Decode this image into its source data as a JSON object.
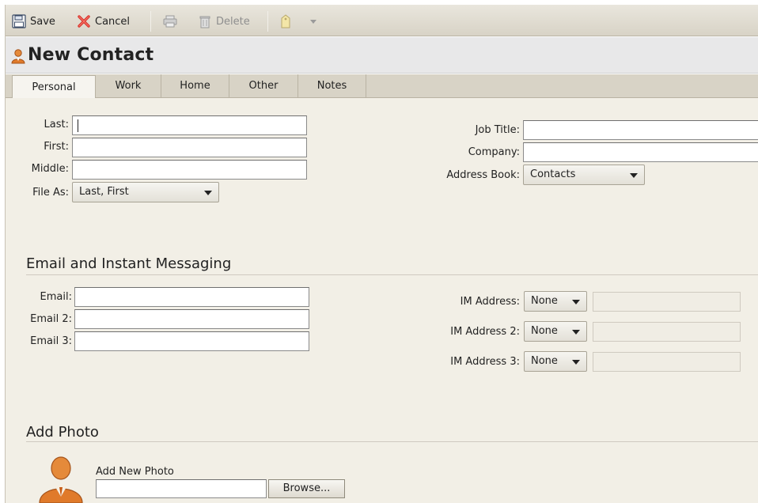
{
  "toolbar": {
    "save_label": "Save",
    "cancel_label": "Cancel",
    "delete_label": "Delete"
  },
  "header": {
    "title": "New Contact"
  },
  "tabs": [
    {
      "label": "Personal",
      "active": true
    },
    {
      "label": "Work",
      "active": false
    },
    {
      "label": "Home",
      "active": false
    },
    {
      "label": "Other",
      "active": false
    },
    {
      "label": "Notes",
      "active": false
    }
  ],
  "personal": {
    "last_label": "Last:",
    "first_label": "First:",
    "middle_label": "Middle:",
    "file_as_label": "File As:",
    "file_as_value": "Last, First",
    "job_title_label": "Job Title:",
    "company_label": "Company:",
    "address_book_label": "Address Book:",
    "address_book_value": "Contacts"
  },
  "email_section": {
    "title": "Email and Instant Messaging",
    "email_label": "Email:",
    "email2_label": "Email 2:",
    "email3_label": "Email 3:",
    "im_label": "IM Address:",
    "im2_label": "IM Address 2:",
    "im3_label": "IM Address 3:",
    "im_value": "None",
    "im2_value": "None",
    "im3_value": "None"
  },
  "photo_section": {
    "title": "Add Photo",
    "add_new_label": "Add New Photo",
    "browse_label": "Browse..."
  },
  "colors": {
    "toolbar_bg": "#d8d3c6",
    "content_bg": "#f2efe6",
    "cancel_icon": "#d9322b",
    "contact_icon": "#e07a2a"
  },
  "icons": {
    "save": "save-icon",
    "cancel": "cancel-icon",
    "print": "print-icon",
    "delete": "trash-icon",
    "tag": "tag-icon",
    "dropdown": "chevron-down-icon",
    "contact": "contact-icon",
    "avatar": "person-avatar-icon"
  }
}
